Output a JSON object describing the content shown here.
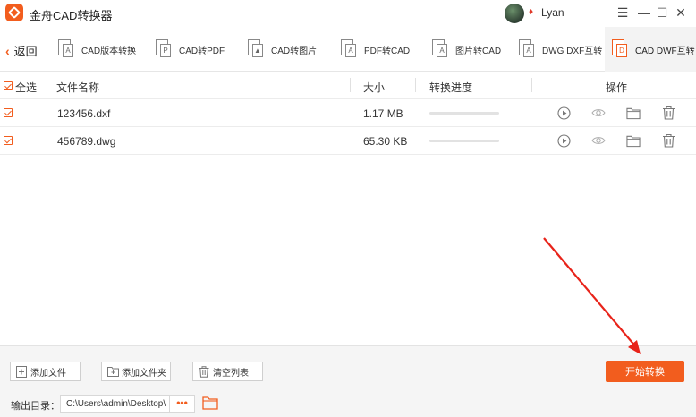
{
  "app": {
    "title": "金舟CAD转换器",
    "username": "Lyan"
  },
  "window_controls": {
    "menu": "☰",
    "minimize": "—",
    "maximize": "☐",
    "close": "✕"
  },
  "nav": {
    "back_label": "返回",
    "tabs": [
      {
        "label": "CAD版本转换",
        "icon": "cad-version-icon"
      },
      {
        "label": "CAD转PDF",
        "icon": "cad-to-pdf-icon"
      },
      {
        "label": "CAD转图片",
        "icon": "cad-to-image-icon"
      },
      {
        "label": "PDF转CAD",
        "icon": "pdf-to-cad-icon"
      },
      {
        "label": "图片转CAD",
        "icon": "image-to-cad-icon"
      },
      {
        "label": "DWG DXF互转",
        "icon": "dwg-dxf-icon"
      },
      {
        "label": "CAD DWF互转",
        "icon": "cad-dwf-icon",
        "active": true
      }
    ]
  },
  "table": {
    "select_all_label": "全选",
    "headers": {
      "name": "文件名称",
      "size": "大小",
      "progress": "转换进度",
      "actions": "操作"
    },
    "rows": [
      {
        "checked": true,
        "name": "123456.dxf",
        "size": "1.17 MB",
        "progress": 0
      },
      {
        "checked": true,
        "name": "456789.dwg",
        "size": "65.30 KB",
        "progress": 0
      }
    ]
  },
  "footer": {
    "add_file_label": "添加文件",
    "add_folder_label": "添加文件夹",
    "clear_list_label": "清空列表",
    "start_label": "开始转换",
    "output_label": "输出目录：",
    "output_path": "C:\\Users\\admin\\Desktop\\",
    "more_label": "•••"
  },
  "colors": {
    "accent": "#f25d1e",
    "annotation_arrow": "#e8231a"
  }
}
